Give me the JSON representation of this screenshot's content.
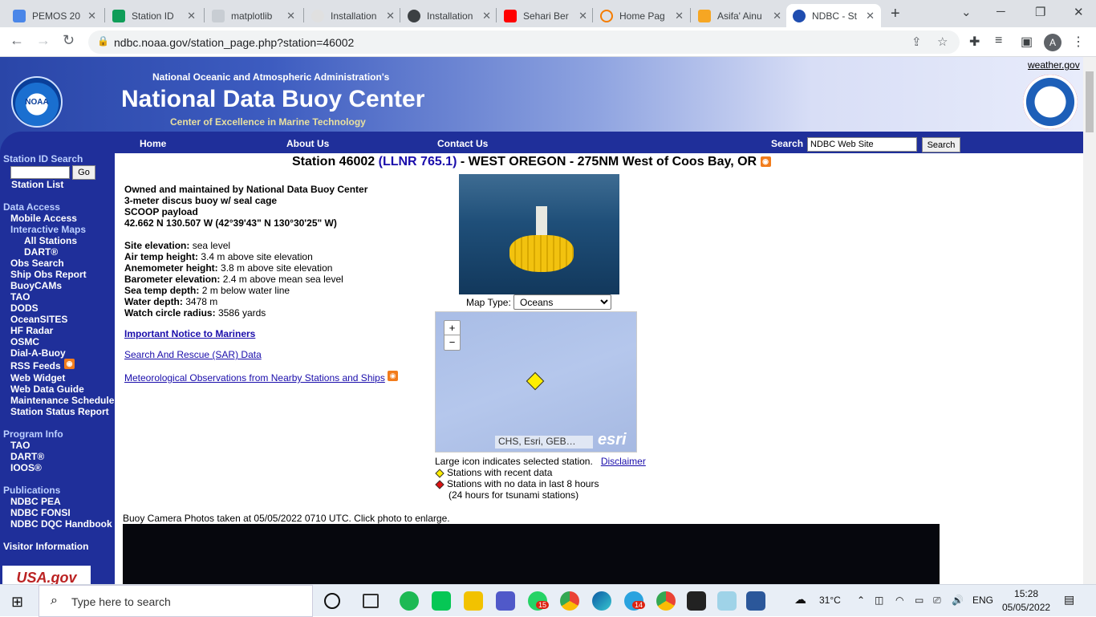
{
  "browser": {
    "tabs": [
      {
        "title": "PEMOS 20",
        "color": "#4a86e8"
      },
      {
        "title": "Station ID",
        "color": "#0f9d58"
      },
      {
        "title": "matplotlib",
        "color": "#9aa0a6"
      },
      {
        "title": "Installation",
        "color": "#5f6368"
      },
      {
        "title": "Installation",
        "color": "#3c4043"
      },
      {
        "title": "Sehari Ber",
        "color": "#ff0000"
      },
      {
        "title": "Home Pag",
        "color": "#f57c00"
      },
      {
        "title": "Asifa' Ainu",
        "color": "#f6a623"
      },
      {
        "title": "NDBC - St",
        "color": "#1f4db0"
      }
    ],
    "url": "ndbc.noaa.gov/station_page.php?station=46002",
    "avatar_letter": "A"
  },
  "header": {
    "org": "National Oceanic and Atmospheric Administration's",
    "title": "National Data Buoy Center",
    "subtitle": "Center of Excellence in Marine Technology",
    "weather_link": "weather.gov",
    "noaa_logo_text": "NOAA",
    "nav": [
      "Home",
      "About Us",
      "Contact Us"
    ],
    "search_label": "Search",
    "search_value": "NDBC Web Site",
    "search_button": "Search"
  },
  "sidebar": {
    "station_id_search": "Station ID Search",
    "go": "Go",
    "station_list": "Station List",
    "data_access": "Data Access",
    "mobile_access": "Mobile Access",
    "interactive_maps": "Interactive Maps",
    "all_stations": "All Stations",
    "dart": "DART®",
    "obs_search": "Obs Search",
    "ship_obs_report": "Ship Obs Report",
    "buoycams": "BuoyCAMs",
    "tao": "TAO",
    "dods": "DODS",
    "oceansites": "OceanSITES",
    "hf_radar": "HF Radar",
    "osmc": "OSMC",
    "dial_a_buoy": "Dial-A-Buoy",
    "rss_feeds": "RSS Feeds",
    "web_widget": "Web Widget",
    "web_data_guide": "Web Data Guide",
    "maintenance_schedule": "Maintenance Schedule",
    "station_status_report": "Station Status Report",
    "program_info": "Program Info",
    "tao2": "TAO",
    "dart2": "DART®",
    "ioos": "IOOS®",
    "publications": "Publications",
    "ndbc_pea": "NDBC PEA",
    "ndbc_fonsi": "NDBC FONSI",
    "ndbc_dqc": "NDBC DQC Handbook",
    "visitor_info": "Visitor Information",
    "usagov": "USA.gov"
  },
  "station": {
    "title_prefix": "Station 46002",
    "llnr": "(LLNR 765.1)",
    "title_suffix": "- WEST OREGON - 275NM West of Coos Bay, OR",
    "owner": "Owned and maintained by National Data Buoy Center",
    "buoy_type": "3-meter discus buoy w/ seal cage",
    "payload": "SCOOP payload",
    "coords": "42.662 N 130.507 W (42°39'43\" N 130°30'25\" W)",
    "site_elevation_label": "Site elevation:",
    "site_elevation": "sea level",
    "air_temp_label": "Air temp height:",
    "air_temp": "3.4 m above site elevation",
    "anemometer_label": "Anemometer height:",
    "anemometer": "3.8 m above site elevation",
    "barometer_label": "Barometer elevation:",
    "barometer": "2.4 m above mean sea level",
    "sea_temp_label": "Sea temp depth:",
    "sea_temp": "2 m below water line",
    "water_depth_label": "Water depth:",
    "water_depth": "3478 m",
    "watch_circle_label": "Watch circle radius:",
    "watch_circle": "3586 yards",
    "link_notice": "Important Notice to Mariners",
    "link_sar": "Search And Rescue (SAR) Data",
    "link_met": "Meteorological Observations from Nearby Stations and Ships"
  },
  "map": {
    "type_label": "Map Type:",
    "type_value": "Oceans",
    "zoom_in": "+",
    "zoom_out": "−",
    "attribution": "CHS, Esri, GEB…",
    "esri": "esri",
    "large_icon_note": "Large icon indicates selected station.",
    "disclaimer": "Disclaimer",
    "legend_recent": "Stations with recent data",
    "legend_nodata": "Stations with no data in last 8 hours",
    "legend_tsunami": "(24 hours for tsunami stations)",
    "colors": {
      "recent": "#ffee00",
      "nodata": "#dd1111"
    }
  },
  "camera": {
    "caption": "Buoy Camera Photos taken at 05/05/2022 0710 UTC. Click photo to enlarge."
  },
  "taskbar": {
    "search_placeholder": "Type here to search",
    "weather": "31°C",
    "lang": "ENG",
    "time": "15:28",
    "date": "05/05/2022",
    "badge_whatsapp": "15",
    "badge_telegram": "14"
  }
}
